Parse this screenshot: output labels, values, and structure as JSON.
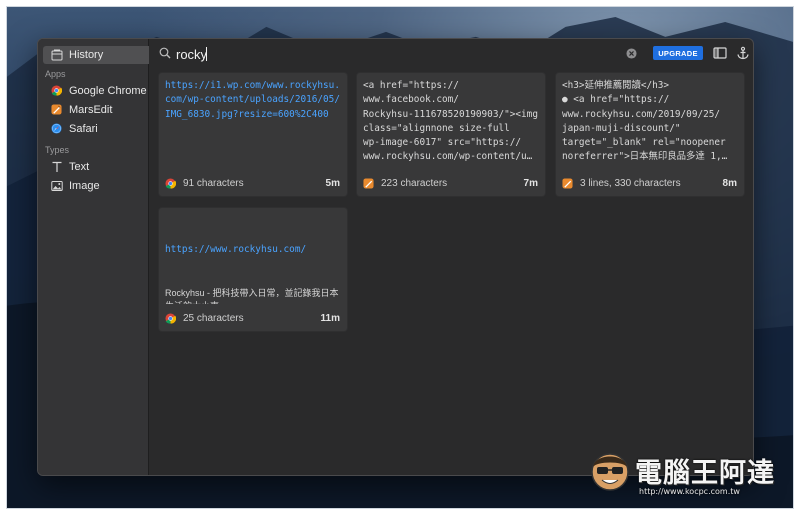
{
  "sidebar": {
    "history_label": "History",
    "apps_heading": "Apps",
    "apps": [
      {
        "label": "Google Chrome",
        "icon": "chrome-icon"
      },
      {
        "label": "MarsEdit",
        "icon": "marsedit-icon"
      },
      {
        "label": "Safari",
        "icon": "safari-icon"
      }
    ],
    "types_heading": "Types",
    "types": [
      {
        "label": "Text",
        "icon": "text-type-icon"
      },
      {
        "label": "Image",
        "icon": "image-type-icon"
      }
    ]
  },
  "search": {
    "value": "rocky",
    "placeholder": ""
  },
  "toolbar": {
    "upgrade_label": "UPGRADE",
    "upgrade_color": "#1f6fe0"
  },
  "cards": [
    {
      "content": "https://i1.wp.com/www.rockyhsu.com/wp-content/uploads/2016/05/IMG_6830.jpg?resize=600%2C400",
      "source_icon": "chrome-icon",
      "meta": "91 characters",
      "time": "5m"
    },
    {
      "content": "<a href=\"https://\nwww.facebook.com/\nRockyhsu-111678520190903/\"><img class=\"alignnone size-full\nwp-image-6017\" src=\"https://\nwww.rockyhsu.com/wp-content/u…",
      "source_icon": "marsedit-icon",
      "meta": "223 characters",
      "time": "7m"
    },
    {
      "content": "<h3>延伸推薦閱讀</h3>\n● <a href=\"https://\nwww.rockyhsu.com/2019/09/25/\njapan-muji-discount/\"\ntarget=\"_blank\" rel=\"noopener\nnoreferrer\">日本無印良品多達 1,…",
      "source_icon": "marsedit-icon",
      "meta": "3 lines, 330 characters",
      "time": "8m"
    },
    {
      "title": "https://www.rockyhsu.com/",
      "description": "Rockyhsu - 把科技帶入日常，並記錄我日本生活的大小事",
      "source_icon": "chrome-icon",
      "meta": "25 characters",
      "time": "11m"
    }
  ],
  "watermark": {
    "text": "電腦王阿達",
    "url": "http://www.kocpc.com.tw"
  }
}
